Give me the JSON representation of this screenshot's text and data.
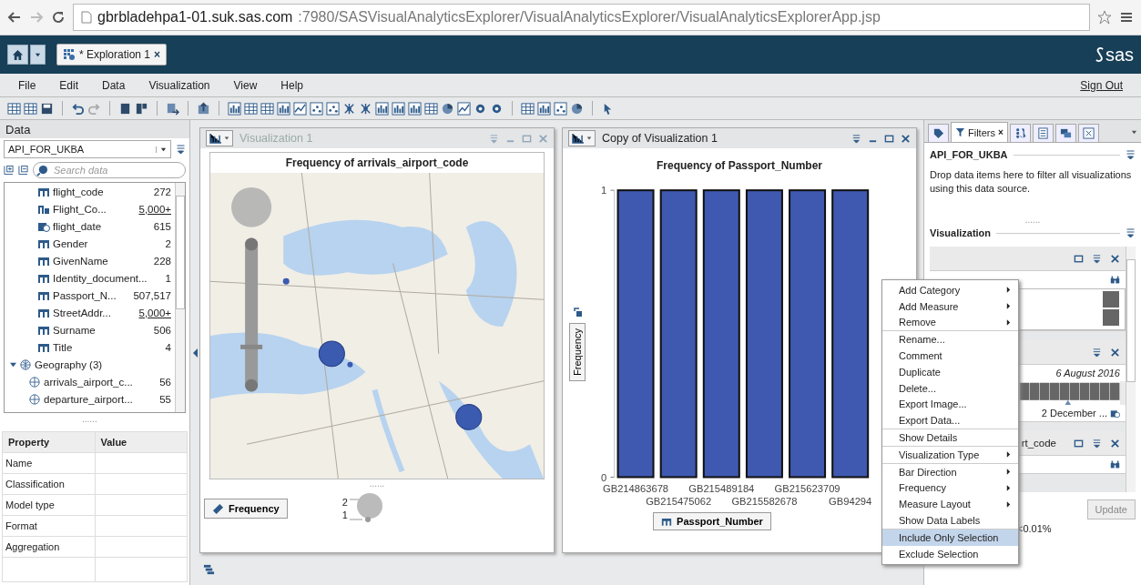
{
  "browser": {
    "url_host": "gbrbladehpa1-01.suk.sas.com",
    "url_rest": ":7980/SASVisualAnalyticsExplorer/VisualAnalyticsExplorer/VisualAnalyticsExplorerApp.jsp"
  },
  "app_header": {
    "tab": {
      "label": "* Exploration 1",
      "close": "×"
    },
    "logo": "sas"
  },
  "menu": [
    "File",
    "Edit",
    "Data",
    "Visualization",
    "View",
    "Help"
  ],
  "sign_out": "Sign Out",
  "data_panel": {
    "title": "Data",
    "source": "API_FOR_UKBA",
    "search": {
      "placeholder": "Search data"
    },
    "items": [
      {
        "kind": "category",
        "name": "flight_code",
        "count": "272",
        "underlined": false
      },
      {
        "kind": "hierarchy",
        "name": "Flight_Co...",
        "count": "5,000+",
        "underlined": true
      },
      {
        "kind": "date",
        "name": "flight_date",
        "count": "615",
        "underlined": false
      },
      {
        "kind": "category",
        "name": "Gender",
        "count": "2",
        "underlined": false
      },
      {
        "kind": "category",
        "name": "GivenName",
        "count": "228",
        "underlined": false
      },
      {
        "kind": "category",
        "name": "Identity_document...",
        "count": "1",
        "underlined": false
      },
      {
        "kind": "category",
        "name": "Passport_N...",
        "count": "507,517",
        "underlined": false
      },
      {
        "kind": "category",
        "name": "StreetAddr...",
        "count": "5,000+",
        "underlined": true
      },
      {
        "kind": "category",
        "name": "Surname",
        "count": "506",
        "underlined": false
      },
      {
        "kind": "category",
        "name": "Title",
        "count": "4",
        "underlined": false
      }
    ],
    "geography": {
      "label": "Geography (3)",
      "expanded": true,
      "children": [
        {
          "kind": "geo",
          "name": "arrivals_airport_c...",
          "count": "56",
          "underlined": false
        },
        {
          "kind": "geo",
          "name": "departure_airport...",
          "count": "55",
          "underlined": false
        }
      ]
    },
    "handle": "......",
    "properties": {
      "columns": [
        "Property",
        "Value"
      ],
      "rows": [
        "Name",
        "Classification",
        "Model type",
        "Format",
        "Aggregation"
      ]
    }
  },
  "map_visualization": {
    "title": "Visualization 1",
    "active": false,
    "chart_title": "Frequency of arrivals_airport_code",
    "role_button": "Frequency",
    "handle": "......",
    "legend": [
      "2",
      "1"
    ]
  },
  "bar_visualization": {
    "title": "Copy of Visualization 1",
    "active": true,
    "chart_data": {
      "type": "bar",
      "title": "Frequency of Passport_Number",
      "xlabel": "Passport_Number",
      "ylabel": "Frequency",
      "categories": [
        "GB214863678",
        "GB215475062",
        "GB215489184",
        "GB215582678",
        "GB215623709",
        "GB94294"
      ],
      "values": [
        1,
        1,
        1,
        1,
        1,
        1
      ],
      "ylim": [
        0,
        1
      ],
      "yticks": [
        0,
        1
      ]
    }
  },
  "right_panel": {
    "tabs": [
      {
        "kind": "icon",
        "selected": false
      },
      {
        "kind": "label",
        "label": "Filters",
        "close": "×",
        "selected": true
      },
      {
        "kind": "icon",
        "selected": false
      },
      {
        "kind": "icon",
        "selected": false
      },
      {
        "kind": "icon",
        "selected": false
      },
      {
        "kind": "icon",
        "selected": false
      }
    ],
    "source": "API_FOR_UKBA",
    "hint": "Drop data items here to filter all visualizations using this data source.",
    "handle": "......",
    "section": "Visualization",
    "date_end": "6 August 2016",
    "date_start": "2 December ...",
    "filter_title": "rt_code",
    "update": "Update",
    "status": "<0.01%"
  },
  "context_menu": {
    "groups": [
      [
        {
          "label": "Add Category",
          "submenu": true,
          "selected": false
        },
        {
          "label": "Add Measure",
          "submenu": true,
          "selected": false
        },
        {
          "label": "Remove",
          "submenu": true,
          "selected": false
        }
      ],
      [
        {
          "label": "Rename...",
          "submenu": false,
          "selected": false
        },
        {
          "label": "Comment",
          "submenu": false,
          "selected": false
        },
        {
          "label": "Duplicate",
          "submenu": false,
          "selected": false
        },
        {
          "label": "Delete...",
          "submenu": false,
          "selected": false
        },
        {
          "label": "Export Image...",
          "submenu": false,
          "selected": false
        },
        {
          "label": "Export Data...",
          "submenu": false,
          "selected": false
        }
      ],
      [
        {
          "label": "Show Details",
          "submenu": false,
          "selected": false
        }
      ],
      [
        {
          "label": "Visualization Type",
          "submenu": true,
          "selected": false
        }
      ],
      [
        {
          "label": "Bar Direction",
          "submenu": true,
          "selected": false
        },
        {
          "label": "Frequency",
          "submenu": true,
          "selected": false
        },
        {
          "label": "Measure Layout",
          "submenu": true,
          "selected": false
        },
        {
          "label": "Show Data Labels",
          "submenu": false,
          "selected": false
        }
      ],
      [
        {
          "label": "Include Only Selection",
          "submenu": false,
          "selected": true
        },
        {
          "label": "Exclude Selection",
          "submenu": false,
          "selected": false
        }
      ]
    ]
  }
}
